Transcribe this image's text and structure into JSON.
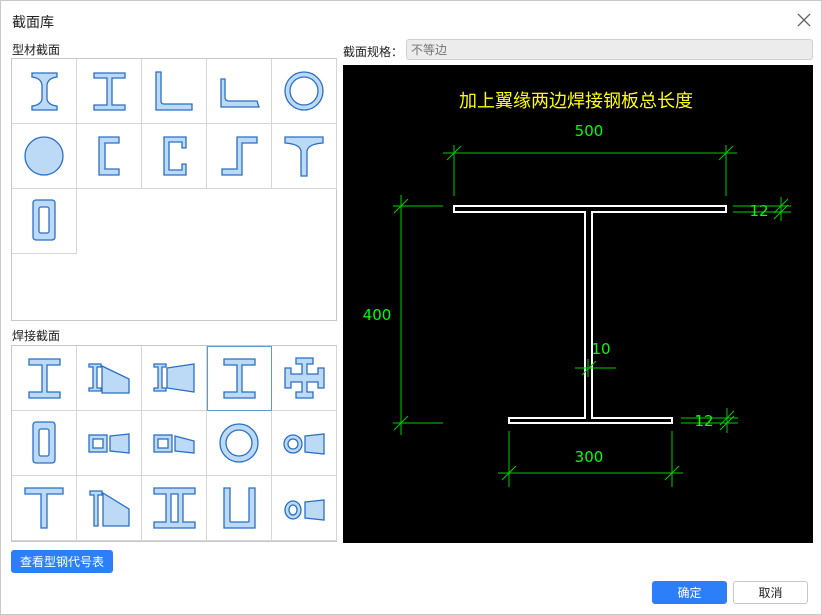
{
  "dialog": {
    "title": "截面库"
  },
  "profile_section": {
    "label": "型材截面",
    "items": [
      {
        "icon": "i-beam-icon"
      },
      {
        "icon": "h-beam-icon"
      },
      {
        "icon": "equal-angle-icon"
      },
      {
        "icon": "unequal-angle-icon"
      },
      {
        "icon": "round-tube-icon"
      },
      {
        "icon": "round-bar-icon"
      },
      {
        "icon": "channel-icon"
      },
      {
        "icon": "lipped-channel-icon"
      },
      {
        "icon": "z-section-icon"
      },
      {
        "icon": "t-section-icon"
      },
      {
        "icon": "rect-tube-icon"
      }
    ]
  },
  "welded_section": {
    "label": "焊接截面",
    "items": [
      {
        "icon": "welded-i-beam-icon"
      },
      {
        "icon": "tapered-i-beam-icon"
      },
      {
        "icon": "tapered-i-beam-2-icon"
      },
      {
        "icon": "welded-i-beam-selected-icon",
        "selected": true
      },
      {
        "icon": "cross-section-icon"
      },
      {
        "icon": "box-section-icon"
      },
      {
        "icon": "tapered-box-icon"
      },
      {
        "icon": "tapered-box-2-icon"
      },
      {
        "icon": "circular-tube-icon"
      },
      {
        "icon": "tapered-tube-icon"
      },
      {
        "icon": "welded-t-icon"
      },
      {
        "icon": "tapered-t-icon"
      },
      {
        "icon": "double-i-icon"
      },
      {
        "icon": "u-section-icon"
      },
      {
        "icon": "tapered-tube-2-icon"
      }
    ]
  },
  "spec": {
    "label": "截面规格：",
    "placeholder": "不等边"
  },
  "preview": {
    "caption": "加上翼缘两边焊接钢板总长度",
    "dims": {
      "top_width": "500",
      "bottom_width": "300",
      "height": "400",
      "top_flange_thk": "12",
      "bottom_flange_thk": "12",
      "web_thk": "10"
    },
    "colors": {
      "caption": "#ffff00",
      "dim": "#00ff00",
      "outline": "#ffffff"
    }
  },
  "buttons": {
    "code_table": "查看型钢代号表",
    "ok": "确定",
    "cancel": "取消"
  }
}
